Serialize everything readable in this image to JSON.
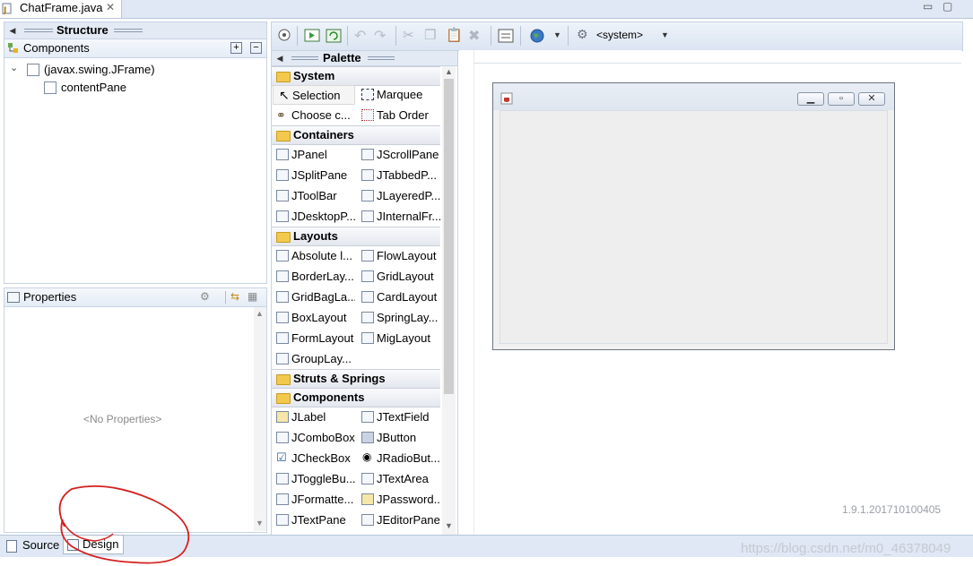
{
  "editor": {
    "tab_label": "ChatFrame.java",
    "close_glyph": "✕"
  },
  "structure": {
    "header_title": "Structure",
    "components_title": "Components",
    "tree": [
      {
        "label": "(javax.swing.JFrame)",
        "level": 0
      },
      {
        "label": "contentPane",
        "level": 1
      }
    ]
  },
  "properties": {
    "title": "Properties",
    "empty_text": "<No Properties>"
  },
  "bottom_tabs": {
    "source": "Source",
    "design": "Design"
  },
  "toolbar": {
    "system_label": "<system>"
  },
  "palette": {
    "title": "Palette",
    "categories": [
      {
        "name": "System",
        "items": [
          "Selection",
          "Marquee",
          "Choose c...",
          "Tab Order"
        ]
      },
      {
        "name": "Containers",
        "items": [
          "JPanel",
          "JScrollPane",
          "JSplitPane",
          "JTabbedP...",
          "JToolBar",
          "JLayeredP...",
          "JDesktopP...",
          "JInternalFr..."
        ]
      },
      {
        "name": "Layouts",
        "items": [
          "Absolute l...",
          "FlowLayout",
          "BorderLay...",
          "GridLayout",
          "GridBagLa...",
          "CardLayout",
          "BoxLayout",
          "SpringLay...",
          "FormLayout",
          "MigLayout",
          "GroupLay..."
        ]
      },
      {
        "name": "Struts & Springs",
        "items": []
      },
      {
        "name": "Components",
        "items": [
          "JLabel",
          "JTextField",
          "JComboBox",
          "JButton",
          "JCheckBox",
          "JRadioBut...",
          "JToggleBu...",
          "JTextArea",
          "JFormatte...",
          "JPassword...",
          "JTextPane",
          "JEditorPane"
        ]
      }
    ]
  },
  "version": "1.9.1.201710100405",
  "watermark": "https://blog.csdn.net/m0_46378049",
  "colors": {
    "accent": "#dfe8f4",
    "annotation": "#d42020"
  }
}
